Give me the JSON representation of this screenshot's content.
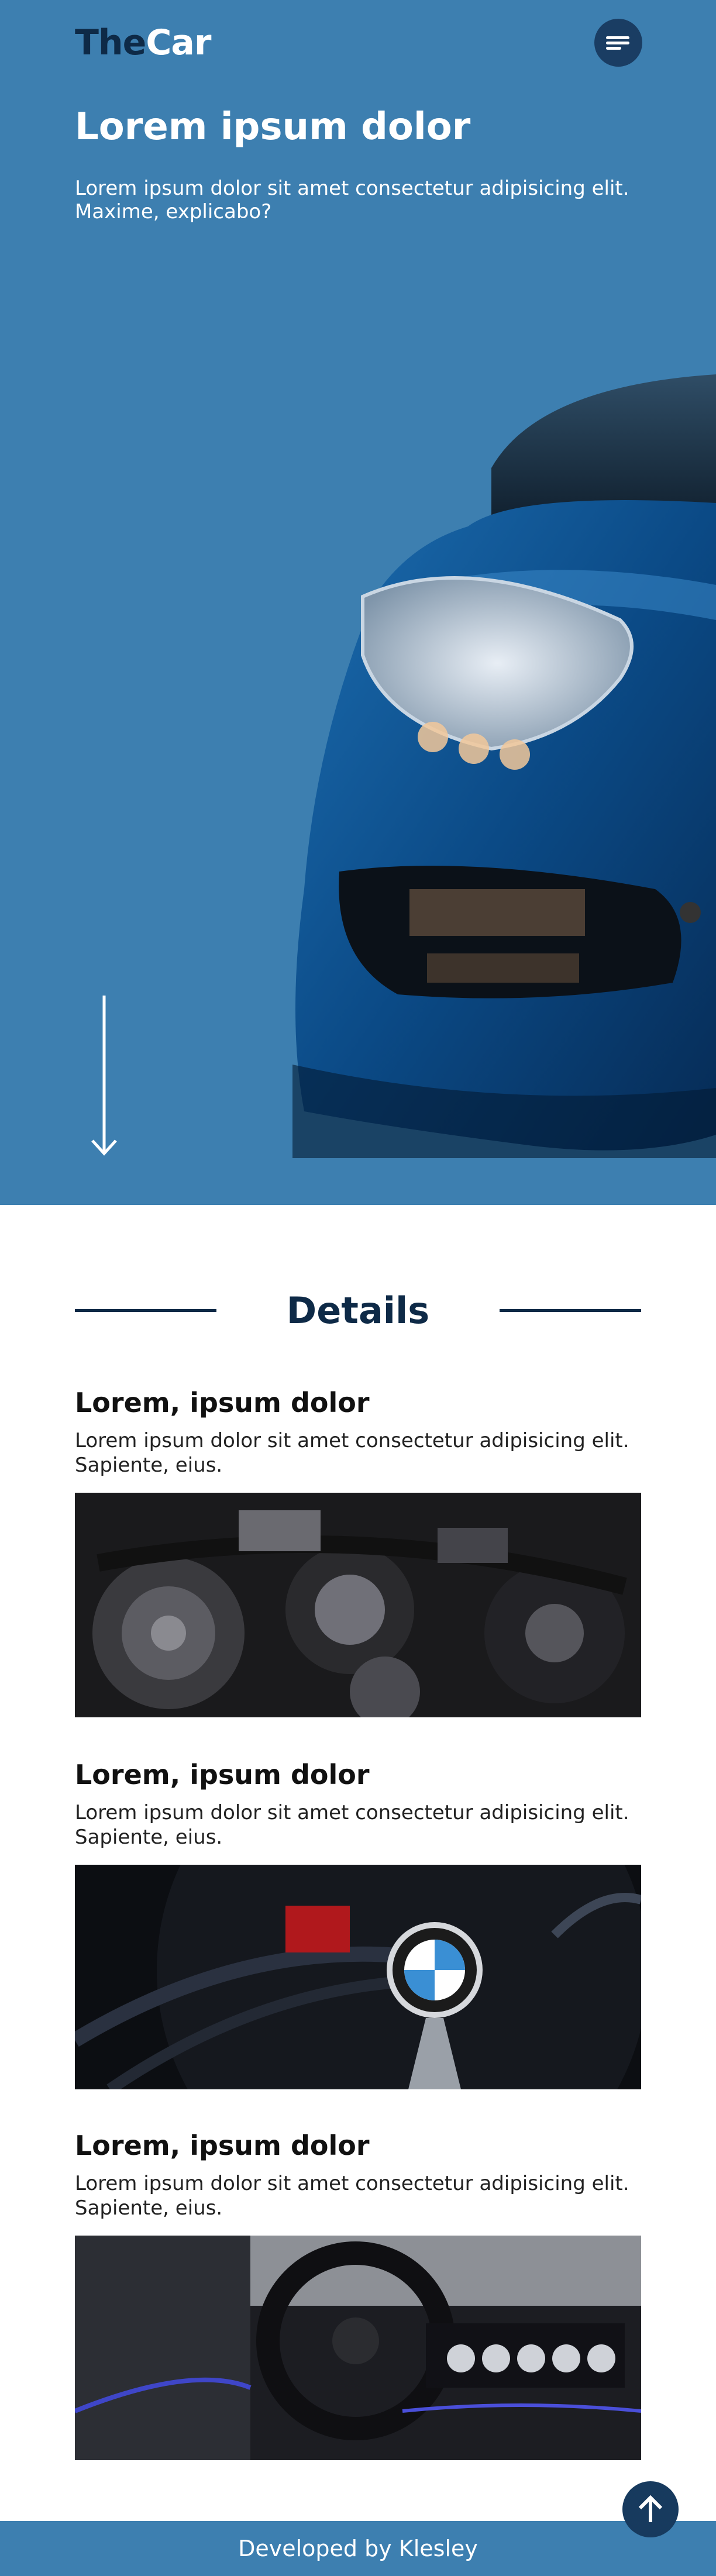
{
  "header": {
    "logo_prefix": "The",
    "logo_suffix": "Car",
    "menu_icon": "hamburger-menu-icon"
  },
  "hero": {
    "title": "Lorem ipsum dolor",
    "text": "Lorem ipsum dolor sit amet consectetur adipisicing elit. Maxime, explicabo?",
    "scroll_icon": "arrow-down-icon",
    "background_color": "#3d7fb0",
    "car_color": "#0d4f8c"
  },
  "details": {
    "heading": "Details",
    "cards": [
      {
        "title": "Lorem, ipsum dolor",
        "text": "Lorem ipsum dolor sit amet consectetur adipisicing elit. Sapiente, eius.",
        "image": "car-engine-photo"
      },
      {
        "title": "Lorem, ipsum dolor",
        "text": "Lorem ipsum dolor sit amet consectetur adipisicing elit. Sapiente, eius.",
        "image": "bmw-wheel-photo"
      },
      {
        "title": "Lorem, ipsum dolor",
        "text": "Lorem ipsum dolor sit amet consectetur adipisicing elit. Sapiente, eius.",
        "image": "car-interior-photo"
      }
    ]
  },
  "footer": {
    "text": "Developed by Klesley",
    "back_to_top_icon": "arrow-up-icon"
  },
  "colors": {
    "primary": "#3d7fb0",
    "dark_navy": "#0e2a47",
    "white": "#ffffff"
  }
}
